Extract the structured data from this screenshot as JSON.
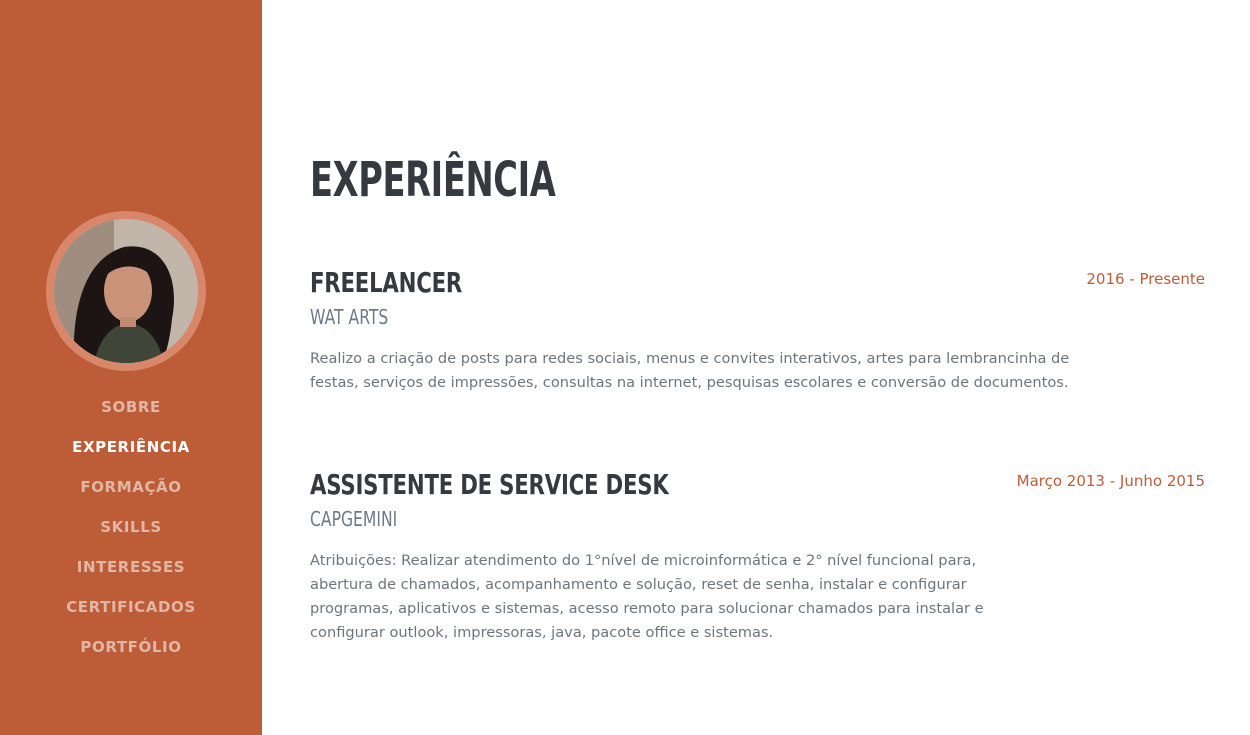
{
  "colors": {
    "sidebar": "#bd5d38",
    "accent": "#bd5d38",
    "heading": "#343a40",
    "muted": "#6c757d"
  },
  "profile": {
    "avatar_icon": "profile-photo"
  },
  "nav": {
    "items": [
      {
        "label": "SOBRE",
        "active": false
      },
      {
        "label": "EXPERIÊNCIA",
        "active": true
      },
      {
        "label": "FORMAÇÃO",
        "active": false
      },
      {
        "label": "SKILLS",
        "active": false
      },
      {
        "label": "INTERESSES",
        "active": false
      },
      {
        "label": "CERTIFICADOS",
        "active": false
      },
      {
        "label": "PORTFÓLIO",
        "active": false
      }
    ]
  },
  "section": {
    "title": "EXPERIÊNCIA"
  },
  "jobs": [
    {
      "title": "FREELANCER",
      "company": "WAT ARTS",
      "date": "2016 - Presente",
      "description": "Realizo a criação de posts para redes sociais, menus e convites interativos, artes para lembrancinha de festas, serviços de impressões, consultas na internet, pesquisas escolares e conversão de documentos."
    },
    {
      "title": "ASSISTENTE DE SERVICE DESK",
      "company": "CAPGEMINI",
      "date": "Março 2013 - Junho 2015",
      "description": "Atribuições: Realizar atendimento do 1°nível de microinformática e 2° nível funcional para, abertura de chamados, acompanhamento e solução, reset de senha, instalar e configurar programas, aplicativos e sistemas, acesso remoto para solucionar chamados para instalar e configurar outlook, impressoras, java, pacote office e sistemas."
    }
  ]
}
